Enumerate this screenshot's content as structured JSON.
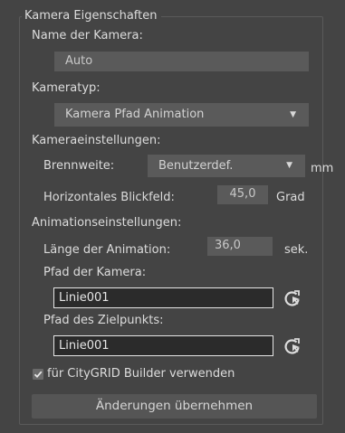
{
  "group": {
    "title": "Kamera Eigenschaften"
  },
  "camera_name": {
    "label": "Name der Kamera:",
    "value": "Auto"
  },
  "camera_type": {
    "label": "Kameratyp:",
    "selected": "Kamera Pfad Animation"
  },
  "camera_settings": {
    "section_label": "Kameraeinstellungen:",
    "focal_length": {
      "label": "Brennweite:",
      "selected": "Benutzerdef.",
      "unit": "mm"
    },
    "fov": {
      "label": "Horizontales Blickfeld:",
      "value": "45,0",
      "unit": "Grad"
    }
  },
  "animation_settings": {
    "section_label": "Animationseinstellungen:",
    "length": {
      "label": "Länge der Animation:",
      "value": "36,0",
      "unit": "sek."
    },
    "camera_path": {
      "label": "Pfad der Kamera:",
      "value": "Linie001"
    },
    "target_path": {
      "label": "Pfad des Zielpunkts:",
      "value": "Linie001"
    }
  },
  "citygrid": {
    "label": "für CityGRID Builder verwenden",
    "checked": true
  },
  "apply_button": {
    "label": "Änderungen übernehmen"
  },
  "icons": {
    "pick": "pick-object-icon",
    "check": "checkmark-icon",
    "dropdown": "chevron-down-icon"
  }
}
